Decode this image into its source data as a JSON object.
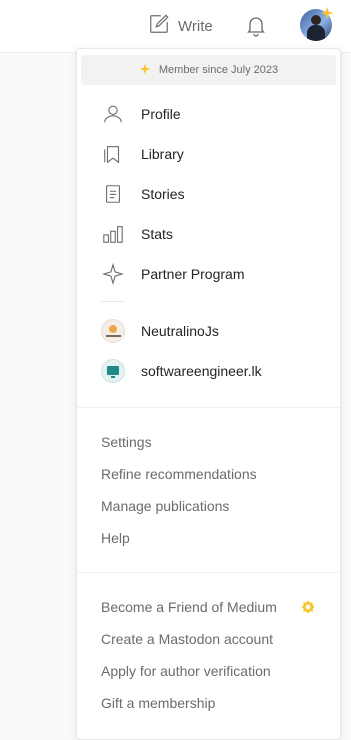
{
  "topbar": {
    "write_label": "Write",
    "write_icon": "pencil-square-icon",
    "bell_icon": "bell-icon",
    "avatar_badge_color": "#f7c432"
  },
  "menu": {
    "member_since": "Member since July 2023",
    "sparkle_color": "#f7c432",
    "items": [
      {
        "label": "Profile",
        "icon": "user-icon"
      },
      {
        "label": "Library",
        "icon": "bookmark-icon"
      },
      {
        "label": "Stories",
        "icon": "document-icon"
      },
      {
        "label": "Stats",
        "icon": "stats-icon"
      },
      {
        "label": "Partner Program",
        "icon": "sparkle-outline-icon"
      }
    ],
    "publications": [
      {
        "label": "NeutralinoJs"
      },
      {
        "label": "softwareengineer.lk"
      }
    ],
    "settings_group": [
      "Settings",
      "Refine recommendations",
      "Manage publications",
      "Help"
    ],
    "membership_group": [
      "Become a Friend of Medium",
      "Create a Mastodon account",
      "Apply for author verification",
      "Gift a membership"
    ],
    "friend_badge_color": "#f7c432"
  }
}
